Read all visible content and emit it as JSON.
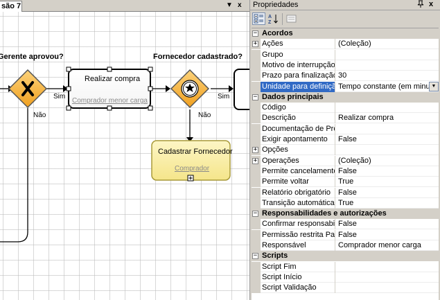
{
  "document": {
    "tab_label": "são 7",
    "dropdown_glyph": "▼",
    "close_glyph": "x"
  },
  "diagram": {
    "gateway1_label": "Gerente aprovou?",
    "gateway2_label": "Fornecedor cadastrado?",
    "task1": {
      "title": "Realizar compra",
      "role": "Comprador menor carga"
    },
    "task2": {
      "title": "Cadastrar Fornecedor",
      "role": "Comprador"
    },
    "sim_label": "Sim",
    "nao_label": "Não",
    "colors": {
      "gateway_fill": "#f7b23a",
      "task2_fill": "#fbefa9",
      "task2_border": "#b8a84a",
      "link_role": "#8a8a8a"
    }
  },
  "properties": {
    "title": "Propriedades",
    "pin_glyph": "♀",
    "close_glyph": "x",
    "categories": [
      {
        "name": "Acordos",
        "rows": [
          {
            "name": "Ações",
            "value": "(Coleção)",
            "expandable": true
          },
          {
            "name": "Grupo",
            "value": ""
          },
          {
            "name": "Motivo de interrupção de",
            "value": ""
          },
          {
            "name": "Prazo para finalização",
            "value": "30"
          },
          {
            "name": "Unidade para definição de",
            "value": "Tempo constante (em minutos)",
            "selected": true,
            "dropdown": true
          }
        ]
      },
      {
        "name": "Dados principais",
        "rows": [
          {
            "name": "Código",
            "value": ""
          },
          {
            "name": "Descrição",
            "value": "Realizar compra"
          },
          {
            "name": "Documentação de Proces",
            "value": ""
          },
          {
            "name": "Exigir apontamento",
            "value": "False"
          },
          {
            "name": "Opções",
            "value": "",
            "expandable": true
          },
          {
            "name": "Operações",
            "value": "(Coleção)",
            "expandable": true
          },
          {
            "name": "Permite cancelamento pe",
            "value": "False"
          },
          {
            "name": "Permite voltar",
            "value": "True"
          },
          {
            "name": "Relatório obrigatório",
            "value": "False"
          },
          {
            "name": "Transição automática",
            "value": "True"
          }
        ]
      },
      {
        "name": "Responsabilidades e autorizações",
        "rows": [
          {
            "name": "Confirmar responsabilida",
            "value": "False"
          },
          {
            "name": "Permissão restrita Papel",
            "value": "False"
          },
          {
            "name": "Responsável",
            "value": "Comprador menor carga"
          }
        ]
      },
      {
        "name": "Scripts",
        "rows": [
          {
            "name": "Script Fim",
            "value": ""
          },
          {
            "name": "Script Início",
            "value": ""
          },
          {
            "name": "Script Validação",
            "value": ""
          }
        ]
      }
    ]
  }
}
